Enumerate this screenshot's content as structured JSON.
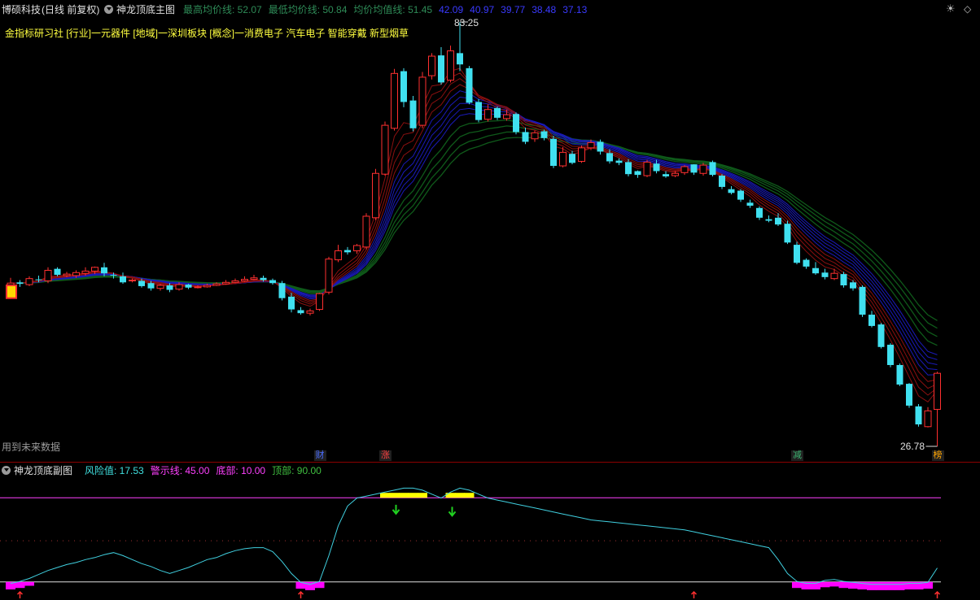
{
  "header": {
    "stock_name": "博硕科技",
    "period": "(日线 前复权)",
    "main_indicator": "神龙顶底主图",
    "stats": [
      {
        "label": "最高均价线:",
        "value": "52.07",
        "color": "#2e8b57"
      },
      {
        "label": "最低均价线:",
        "value": "50.84",
        "color": "#2e8b57"
      },
      {
        "label": "均价均值线:",
        "value": "51.45",
        "color": "#2e8b57"
      },
      {
        "label": "",
        "value": "42.09",
        "color": "#3a3aff"
      },
      {
        "label": "",
        "value": "40.97",
        "color": "#3a3aff"
      },
      {
        "label": "",
        "value": "39.77",
        "color": "#3a3aff"
      },
      {
        "label": "",
        "value": "38.48",
        "color": "#3a3aff"
      },
      {
        "label": "",
        "value": "37.13",
        "color": "#3a3aff"
      }
    ]
  },
  "info_line": "金指标研习社 [行业]一元器件 [地域]一深圳板块 [概念]一消费电子 汽车电子 智能穿戴 新型烟草",
  "future_data_note": "用到未来数据",
  "price_labels": {
    "high": "83.25",
    "low": "26.78"
  },
  "event_markers": [
    {
      "text": "财",
      "bar": 33,
      "color": "#4a6cff"
    },
    {
      "text": "涨",
      "bar": 40,
      "color": "#ff4040"
    },
    {
      "text": "减",
      "bar": 84,
      "color": "#3cb371"
    },
    {
      "text": "榜",
      "bar": 99,
      "color": "#ffa500"
    }
  ],
  "sub_panel": {
    "title": "神龙顶底副图",
    "labels": [
      {
        "label": "风险值:",
        "value": "17.53",
        "color": "#40e0e0"
      },
      {
        "label": "警示线:",
        "value": "45.00",
        "color": "#ff40ff"
      },
      {
        "label": "底部:",
        "value": "10.00",
        "color": "#ff40ff"
      },
      {
        "label": "顶部:",
        "value": "90.00",
        "color": "#40c040"
      }
    ]
  },
  "colors": {
    "up": "#ff3030",
    "down": "#40e0f0",
    "fast_ma": "#8b1010",
    "mid_ma": "#1a1ab8",
    "slow_ma": "#0f5a1a",
    "risk_line": "#40d0e0",
    "warn_line": "#ff40ff",
    "bottom_bar": "#ff00ff",
    "top_bar": "#ffff00"
  },
  "chart_data": [
    {
      "type": "candlestick",
      "title": "神龙顶底主图",
      "ylim": [
        26.78,
        83.25
      ],
      "start_close": 48.5,
      "closes": [
        48.5,
        48.4,
        49.1,
        48.9,
        50.2,
        49.6,
        49.7,
        49.9,
        50.1,
        50.6,
        49.8,
        49.5,
        48.6,
        48.9,
        48.1,
        47.8,
        48.2,
        47.6,
        48.3,
        47.9,
        48.0,
        48.2,
        48.4,
        48.6,
        48.8,
        49.0,
        49.2,
        48.9,
        48.5,
        46.5,
        45.0,
        44.5,
        44.8,
        47.1,
        51.7,
        52.8,
        52.6,
        53.5,
        57.4,
        63.1,
        69.5,
        76.4,
        72.6,
        69.1,
        75.9,
        78.7,
        75.2,
        79.4,
        77.6,
        72.5,
        70.2,
        71.6,
        70.5,
        70.9,
        68.6,
        67.3,
        68.5,
        67.8,
        64.1,
        65.9,
        64.5,
        66.5,
        67.2,
        66.0,
        64.7,
        64.5,
        63.0,
        62.9,
        64.6,
        63.4,
        62.7,
        63.1,
        64.0,
        63.2,
        64.2,
        62.9,
        61.3,
        60.5,
        59.6,
        58.8,
        57.2,
        56.8,
        56.3,
        53.9,
        51.2,
        50.7,
        49.8,
        49.3,
        49.8,
        48.2,
        47.8,
        44.3,
        42.8,
        40.0,
        37.6,
        35.0,
        32.2,
        29.7,
        31.5,
        36.5
      ],
      "opens": [
        46.7,
        48.6,
        48.3,
        49.0,
        48.8,
        50.4,
        49.5,
        49.5,
        49.8,
        50.1,
        50.6,
        49.6,
        49.4,
        48.8,
        48.8,
        48.5,
        47.8,
        48.2,
        47.7,
        48.3,
        47.9,
        48.0,
        48.2,
        48.4,
        48.6,
        48.8,
        49.0,
        49.2,
        48.9,
        48.5,
        46.7,
        44.9,
        44.5,
        45.0,
        47.3,
        51.6,
        52.9,
        52.8,
        53.3,
        57.2,
        63.0,
        69.1,
        76.7,
        72.8,
        69.5,
        76.1,
        78.8,
        75.5,
        79.1,
        77.1,
        72.6,
        70.3,
        71.8,
        70.4,
        71.0,
        68.6,
        67.7,
        68.7,
        67.7,
        64.1,
        65.7,
        64.7,
        66.5,
        67.3,
        65.8,
        64.8,
        64.6,
        63.4,
        62.8,
        64.4,
        63.0,
        62.8,
        63.2,
        64.3,
        63.1,
        64.6,
        62.8,
        61.0,
        60.8,
        59.2,
        58.5,
        57.0,
        57.2,
        56.4,
        53.6,
        51.6,
        50.5,
        49.9,
        49.1,
        49.7,
        48.6,
        48.0,
        44.3,
        43.0,
        40.3,
        37.6,
        35.1,
        32.1,
        29.4,
        31.7
      ],
      "highs": [
        49.2,
        48.9,
        49.4,
        49.5,
        50.6,
        50.6,
        50.0,
        50.2,
        50.6,
        50.7,
        51.2,
        49.9,
        49.9,
        49.1,
        49.1,
        48.8,
        48.4,
        48.5,
        48.6,
        48.4,
        48.2,
        48.4,
        48.6,
        48.9,
        49.1,
        49.4,
        49.6,
        49.5,
        49.1,
        48.8,
        47.2,
        45.3,
        45.1,
        47.2,
        52.0,
        53.6,
        53.3,
        53.7,
        57.8,
        63.7,
        70.0,
        77.0,
        77.1,
        73.4,
        76.6,
        79.1,
        79.9,
        80.1,
        83.25,
        77.4,
        73.0,
        72.3,
        72.0,
        71.6,
        71.2,
        69.2,
        68.8,
        68.9,
        68.1,
        66.6,
        66.1,
        66.8,
        67.6,
        67.6,
        66.3,
        65.1,
        65.0,
        63.5,
        64.9,
        64.9,
        63.4,
        63.4,
        64.2,
        64.3,
        64.5,
        64.8,
        63.0,
        61.4,
        61.0,
        59.6,
        58.7,
        57.5,
        57.8,
        56.8,
        54.0,
        51.8,
        51.3,
        50.4,
        50.4,
        50.0,
        48.9,
        48.2,
        44.8,
        43.2,
        40.5,
        37.8,
        35.2,
        32.4,
        32.0,
        36.7
      ],
      "lows": [
        46.4,
        48.0,
        48.1,
        48.6,
        48.5,
        49.4,
        49.3,
        49.2,
        49.5,
        49.7,
        49.4,
        49.1,
        48.4,
        48.6,
        47.9,
        47.5,
        47.5,
        47.3,
        47.5,
        47.7,
        47.8,
        47.9,
        48.1,
        48.3,
        48.5,
        48.7,
        48.9,
        48.7,
        48.3,
        46.2,
        44.6,
        44.3,
        44.2,
        44.8,
        47.0,
        51.3,
        52.3,
        52.4,
        53.0,
        56.9,
        62.8,
        68.8,
        71.9,
        68.7,
        69.1,
        75.6,
        74.9,
        75.2,
        76.7,
        72.3,
        69.9,
        70.0,
        70.2,
        70.1,
        68.3,
        67.0,
        67.3,
        67.5,
        63.8,
        63.9,
        64.3,
        64.5,
        66.2,
        65.6,
        64.4,
        64.2,
        62.7,
        62.5,
        62.6,
        63.1,
        62.5,
        62.6,
        62.9,
        62.9,
        62.8,
        62.7,
        61.0,
        60.3,
        59.3,
        58.5,
        56.9,
        56.6,
        56.1,
        53.7,
        51.0,
        50.4,
        49.6,
        49.0,
        48.9,
        47.9,
        47.5,
        44.0,
        42.6,
        39.8,
        37.3,
        34.8,
        31.9,
        29.4,
        29.3,
        26.78
      ]
    },
    {
      "type": "line",
      "title": "神龙顶底副图",
      "ylim": [
        0,
        100
      ],
      "series": [
        {
          "name": "风险值",
          "values": [
            2,
            4,
            7,
            11,
            15,
            18,
            21,
            23,
            26,
            28,
            31,
            33,
            30,
            26,
            22,
            19,
            15,
            12,
            15,
            18,
            22,
            26,
            28,
            32,
            35,
            37,
            38,
            38,
            34,
            24,
            12,
            3,
            1,
            4,
            30,
            60,
            80,
            88,
            90,
            92,
            94,
            96,
            98,
            98,
            96,
            92,
            88,
            94,
            98,
            96,
            92,
            88,
            86,
            84,
            82,
            80,
            78,
            76,
            74,
            72,
            70,
            68,
            66,
            65,
            64,
            63,
            62,
            61,
            60,
            59,
            58,
            57,
            56,
            54,
            52,
            50,
            48,
            46,
            44,
            42,
            40,
            38,
            26,
            12,
            4,
            2,
            2,
            5,
            6,
            4,
            3,
            2,
            1,
            1,
            1,
            1,
            2,
            2,
            3,
            17.53
          ]
        }
      ],
      "warning_line": 45.0,
      "bottom_line": 10.0,
      "top_line": 90.0
    }
  ]
}
